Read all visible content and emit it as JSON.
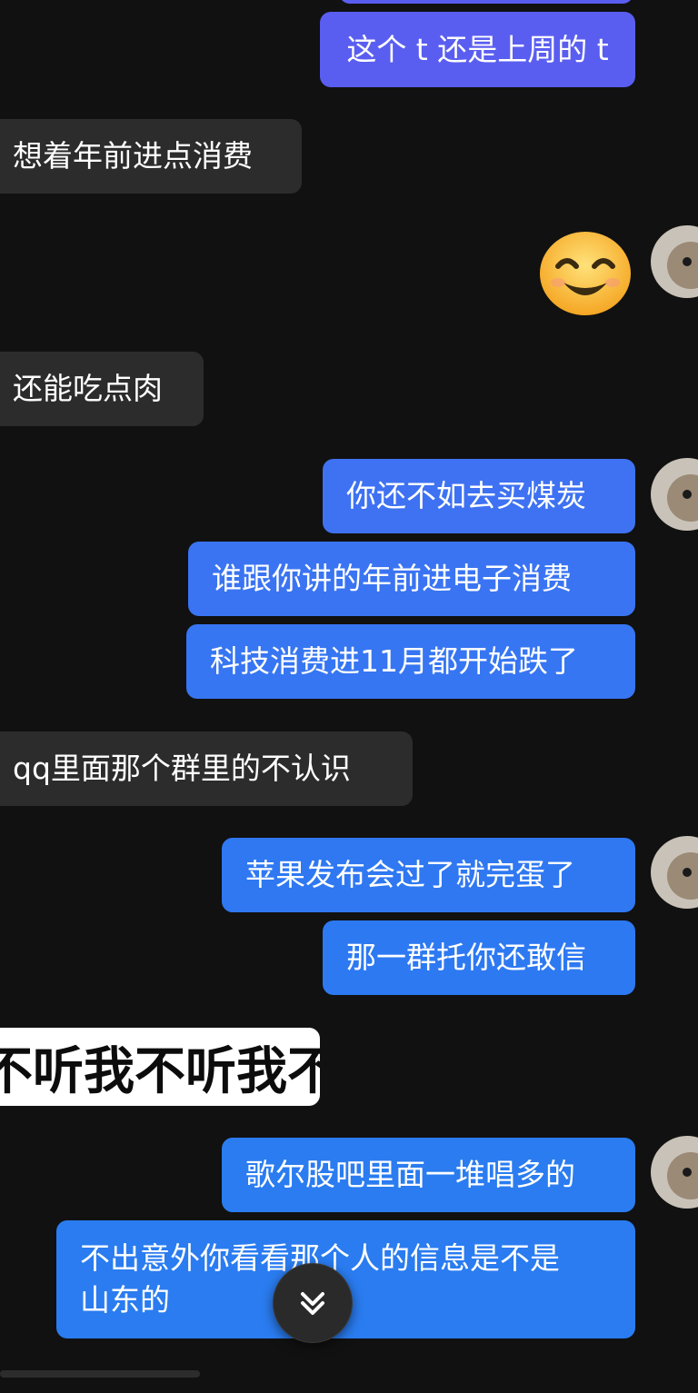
{
  "colors": {
    "background": "#111111",
    "incoming_bubble": "#2c2c2c",
    "outgoing_purple": "#5a5ef0",
    "outgoing_blue_light": "#3e72f2",
    "outgoing_blue": "#2a7cf0",
    "text": "#ffffff"
  },
  "messages": {
    "m1": "这个 t 还是上周的 t",
    "m2": "想着年前进点消费",
    "m3": "还能吃点肉",
    "m4": "你还不如去买煤炭",
    "m5": "谁跟你讲的年前进电子消费",
    "m6": "科技消费进11月都开始跌了",
    "m7": "qq里面那个群里的不认识",
    "m8": "苹果发布会过了就完蛋了",
    "m9": "那一群托你还敢信",
    "m10": "歌尔股吧里面一堆唱多的",
    "m11_line1": "不出意外你看看那个人的信息是不是",
    "m11_line2": "山东的"
  },
  "sticker": {
    "text": "不听我不听我不"
  },
  "emoji": {
    "icon": "smiling-face-emoji"
  },
  "scroll_button": {
    "icon": "double-chevron-down-icon"
  }
}
